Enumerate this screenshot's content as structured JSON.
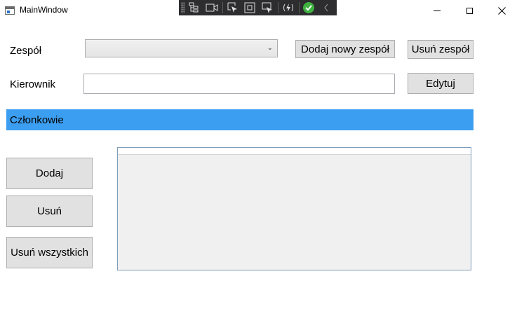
{
  "window": {
    "title": "MainWindow",
    "controls": [
      "minimize-icon",
      "maximize-icon",
      "close-icon"
    ]
  },
  "devtools_toolbar": {
    "icons": [
      "live-visual-tree-icon",
      "record-icon",
      "select-element-icon",
      "display-layout-adorners-icon",
      "track-focus-icon",
      "hot-reload-icon",
      "check-status-icon",
      "collapse-chevron-icon"
    ]
  },
  "form": {
    "team_label": "Zespół",
    "team_selected": "",
    "add_team_button": "Dodaj nowy zespół",
    "remove_team_button": "Usuń zespół",
    "manager_label": "Kierownik",
    "manager_value": "",
    "edit_button": "Edytuj",
    "members_header": "Członkowie",
    "add_button": "Dodaj",
    "remove_button": "Usuń",
    "remove_all_button": "Usuń wszystkich",
    "members": []
  },
  "colors": {
    "section_bar": "#3c9ef0",
    "button_bg": "#e1e1e1",
    "devbar_bg": "#2d2d30",
    "status_ok": "#3fb13f"
  }
}
